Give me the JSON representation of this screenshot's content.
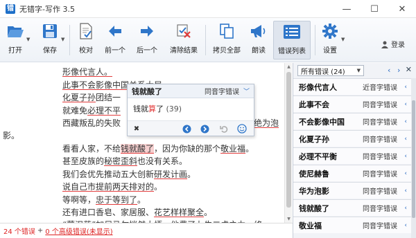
{
  "window": {
    "title": "无错字-写作 3.5",
    "logo_char": "错",
    "minimize": "—",
    "maximize": "☐",
    "close": "✕"
  },
  "toolbar": {
    "open": "打开",
    "save": "保存",
    "proofread": "校对",
    "prev": "前一个",
    "next": "后一个",
    "clear": "清除结果",
    "copy_all": "拷贝全部",
    "read_aloud": "朗读",
    "error_list": "错误列表",
    "settings": "设置",
    "login": "登录"
  },
  "document": {
    "lines": [
      {
        "segments": [
          {
            "t": "形像代言人。",
            "e": true
          }
        ]
      },
      {
        "segments": [
          {
            "t": "此事不会影像中国关系大局",
            "e": true
          }
        ]
      },
      {
        "segments": [
          {
            "t": "化夏子孙",
            "e": true
          },
          {
            "t": "团结一",
            "e": false
          }
        ]
      },
      {
        "segments": [
          {
            "t": "就难免",
            "e": false
          },
          {
            "t": "必理不平",
            "e": true
          }
        ]
      },
      {
        "segments": [
          {
            "t": "西藏叛乱的失败",
            "e": false
          }
        ]
      },
      {
        "segments": [
          {
            "t": "绝为泡",
            "e": true
          }
        ]
      },
      {
        "segments": [
          {
            "t": "影。",
            "e": false
          }
        ]
      },
      {
        "segments": [
          {
            "t": "看看人家，不给",
            "e": false
          },
          {
            "t": "钱就酸了",
            "e": true,
            "sel": true
          },
          {
            "t": "，因为你缺的那个",
            "e": false
          },
          {
            "t": "敬业福",
            "e": true
          },
          {
            "t": "。",
            "e": false
          }
        ]
      },
      {
        "segments": [
          {
            "t": "甚至皮族的",
            "e": false
          },
          {
            "t": "秘密歪斜",
            "e": true
          },
          {
            "t": "也没有关系。",
            "e": false
          }
        ]
      },
      {
        "segments": [
          {
            "t": "我们会优先推动五大创新",
            "e": false
          },
          {
            "t": "研发计画",
            "e": true
          },
          {
            "t": "。",
            "e": false
          }
        ]
      },
      {
        "segments": [
          {
            "t": "说自己市提前两天排对的",
            "e": true
          },
          {
            "t": "。",
            "e": false
          }
        ]
      },
      {
        "segments": [
          {
            "t": "等啊等，",
            "e": false
          },
          {
            "t": "忠于等到了",
            "e": true
          },
          {
            "t": "。",
            "e": false
          }
        ]
      },
      {
        "segments": [
          {
            "t": "还有进口香皂、家居服、",
            "e": false
          },
          {
            "t": "花艺样样聚全",
            "e": true
          },
          {
            "t": "。",
            "e": false
          }
        ]
      },
      {
        "segments": [
          {
            "t": "“蒙汉药”加尼马尔恍然大悟，他费了九牛二虎之力，终",
            "e": false
          }
        ]
      }
    ]
  },
  "popup": {
    "error_text": "钱就酸了",
    "type": "同音字错误",
    "suggestion_pre": "钱就",
    "suggestion_hl": "算",
    "suggestion_post": "了",
    "count": "(39)",
    "dismiss_icon": "✖"
  },
  "panel": {
    "filter": "所有错误 (24)",
    "errors": [
      {
        "text": "形像代言人",
        "type": "近音字错误"
      },
      {
        "text": "此事不会",
        "type": "同音字错误"
      },
      {
        "text": "不会影像中国",
        "type": "同音字错误"
      },
      {
        "text": "化夏子孙",
        "type": "同音字错误"
      },
      {
        "text": "必理不平衡",
        "type": "同音字错误"
      },
      {
        "text": "使尼赫鲁",
        "type": "同音字错误"
      },
      {
        "text": "华为泡影",
        "type": "同音字错误"
      },
      {
        "text": "钱就酸了",
        "type": "同音字错误"
      },
      {
        "text": "敬业福",
        "type": "同音字错误"
      }
    ]
  },
  "status": {
    "errors": "24 个错误",
    "plus": "+",
    "advanced": "0 个高级错误(未显示)"
  },
  "colors": {
    "accent": "#1e6fc8",
    "error": "#e23b3b"
  }
}
